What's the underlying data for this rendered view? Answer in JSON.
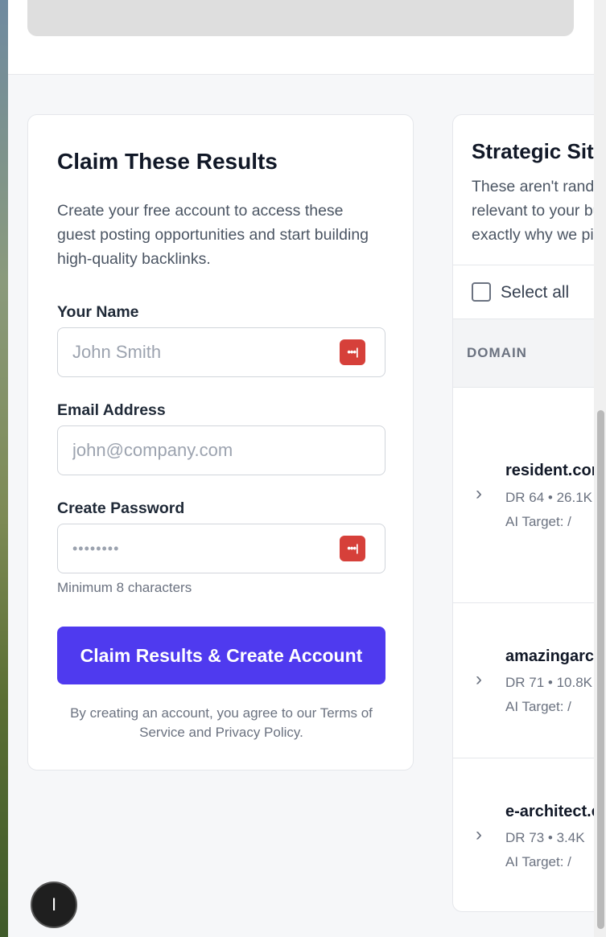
{
  "claim_form": {
    "title": "Claim These Results",
    "description": "Create your free account to access these guest posting opportunities and start building high-quality backlinks.",
    "name_label": "Your Name",
    "name_placeholder": "John Smith",
    "email_label": "Email Address",
    "email_placeholder": "john@company.com",
    "password_label": "Create Password",
    "password_value": "••••••••",
    "password_hint": "Minimum 8 characters",
    "submit_label": "Claim Results & Create Account",
    "legal_text": "By creating an account, you agree to our Terms of Service and Privacy Policy.",
    "password_manager_icon": "•••|"
  },
  "sites_panel": {
    "title": "Strategic Sites",
    "description": "These aren't random sites. Each one is relevant to your business and we explain exactly why we picked it.",
    "select_all_label": "Select all",
    "column_header": "DOMAIN",
    "rows": [
      {
        "domain": "resident.com",
        "stats": "DR 64 • 26.1K",
        "ai_target": "AI Target: /"
      },
      {
        "domain": "amazingarchitecture.com",
        "stats": "DR 71 • 10.8K",
        "ai_target": "AI Target: /"
      },
      {
        "domain": "e-architect.com",
        "stats": "DR 73 • 3.4K",
        "ai_target": "AI Target: /"
      }
    ]
  },
  "floating_button": {
    "label": "I"
  },
  "colors": {
    "primary": "#4f3aef",
    "password_manager": "#d6403a"
  }
}
